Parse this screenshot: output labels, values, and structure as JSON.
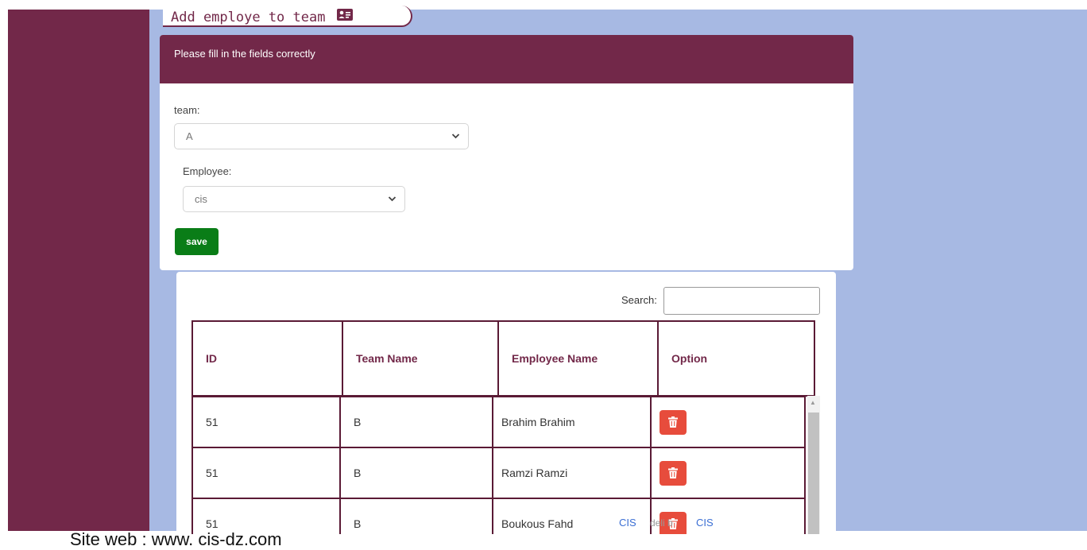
{
  "page": {
    "title": "Add employe to team",
    "title_icon": "id-card-icon",
    "footer": "Site web : www. cis-dz.com"
  },
  "form": {
    "header": "Please fill in the fields correctly",
    "team_label": "team:",
    "team_value": "A",
    "employee_label": "Employee:",
    "employee_value": "cis",
    "save_label": "save"
  },
  "table": {
    "search_label": "Search:",
    "search_value": "",
    "columns": [
      "ID",
      "Team Name",
      "Employee Name",
      "Option"
    ],
    "rows": [
      {
        "id": "51",
        "team": "B",
        "employee": "Brahim Brahim",
        "option_icon": "trash-icon"
      },
      {
        "id": "51",
        "team": "B",
        "employee": "Ramzi Ramzi",
        "option_icon": "trash-icon"
      },
      {
        "id": "51",
        "team": "B",
        "employee": "Boukous Fahd",
        "option_icon": "trash-icon"
      }
    ]
  },
  "overlay": {
    "link1": "CIS",
    "faint": "deli b",
    "link2": "CIS"
  },
  "colors": {
    "brand": "#722849",
    "background": "#a7b9e3",
    "save": "#0a7d17",
    "delete": "#e74c3c"
  }
}
